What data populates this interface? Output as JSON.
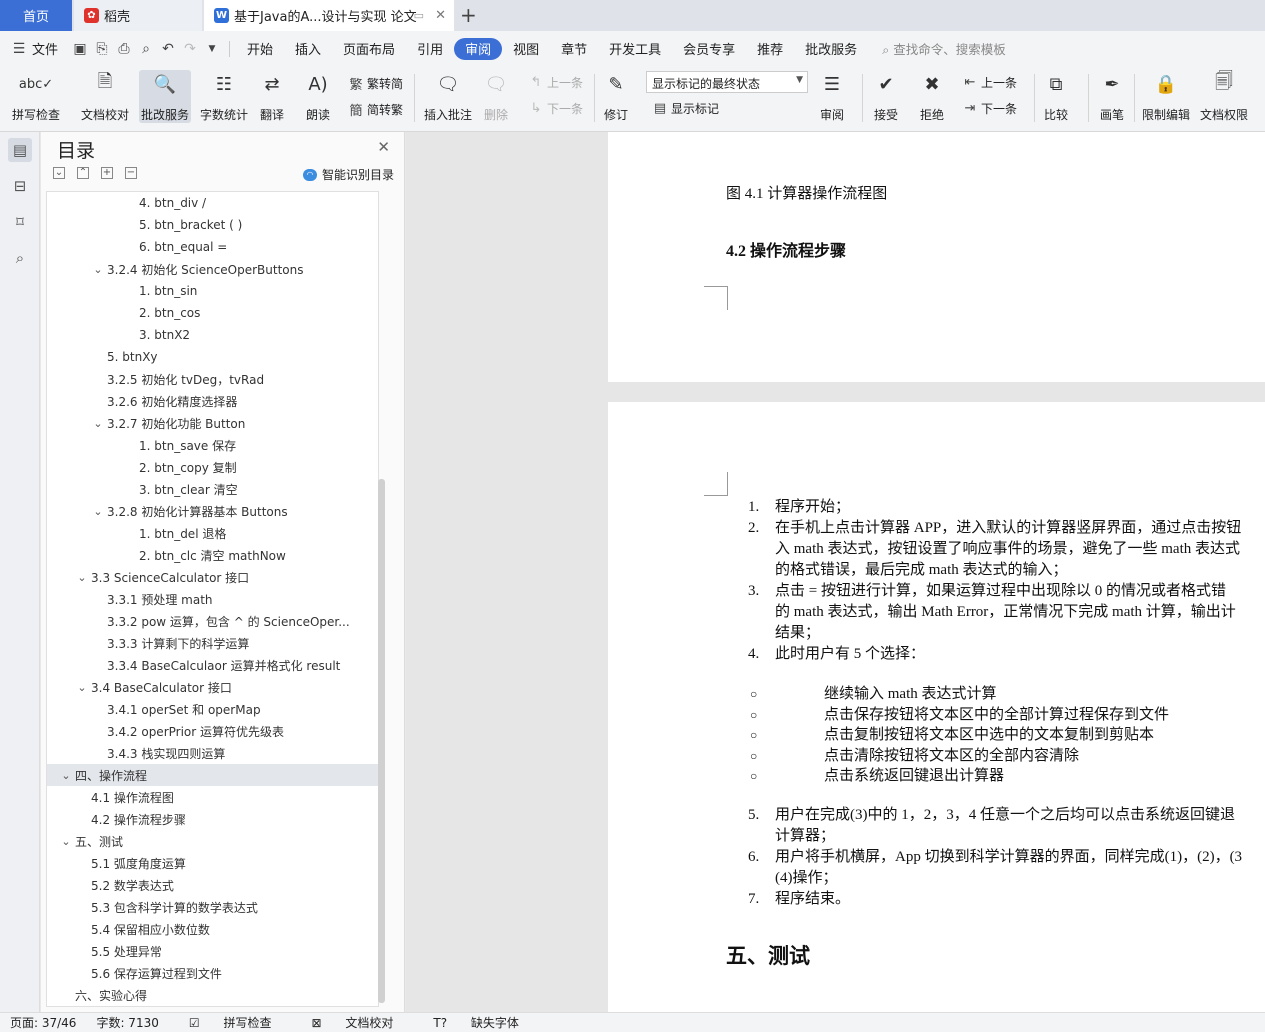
{
  "tabs": {
    "home": "首页",
    "daoke": "稻壳",
    "doc": "基于Java的A...设计与实现 论文"
  },
  "menu": {
    "file": "文件",
    "items": [
      "开始",
      "插入",
      "页面布局",
      "引用",
      "审阅",
      "视图",
      "章节",
      "开发工具",
      "会员专享",
      "推荐",
      "批改服务"
    ],
    "active_index": 4,
    "search": "查找命令、搜索模板"
  },
  "ribbon": {
    "spell": "拼写检查",
    "proofread": "文档校对",
    "correction": "批改服务",
    "wordcount": "字数统计",
    "translate": "翻译",
    "read": "朗读",
    "to_traditional": "繁转简",
    "to_simplified": "简转繁",
    "insert_comment": "插入批注",
    "delete": "删除",
    "prev": "上一条",
    "next": "下一条",
    "track": "修订",
    "markup_state": "显示标记的最终状态",
    "show_markup": "显示标记",
    "review": "审阅",
    "accept": "接受",
    "reject": "拒绝",
    "prev2": "上一条",
    "next2": "下一条",
    "compare": "比较",
    "pen": "画笔",
    "restrict": "限制编辑",
    "permission": "文档权限"
  },
  "toc": {
    "title": "目录",
    "smart": "智能识别目录",
    "items": [
      {
        "text": "4. btn_div /",
        "indent": 3
      },
      {
        "text": "5. btn_bracket ( )",
        "indent": 3
      },
      {
        "text": "6. btn_equal =",
        "indent": 3
      },
      {
        "text": "3.2.4  初始化 ScienceOperButtons",
        "indent": 2,
        "tw": "﹀"
      },
      {
        "text": "1. btn_sin",
        "indent": 3
      },
      {
        "text": "2. btn_cos",
        "indent": 3
      },
      {
        "text": "3. btnX2",
        "indent": 3
      },
      {
        "text": "5. btnXy",
        "indent": 2
      },
      {
        "text": "3.2.5  初始化 tvDeg，tvRad",
        "indent": 2
      },
      {
        "text": "3.2.6  初始化精度选择器",
        "indent": 2
      },
      {
        "text": "3.2.7  初始化功能 Button",
        "indent": 2,
        "tw": "﹀"
      },
      {
        "text": "1. btn_save  保存",
        "indent": 3
      },
      {
        "text": "2. btn_copy  复制",
        "indent": 3
      },
      {
        "text": "3. btn_clear  清空",
        "indent": 3
      },
      {
        "text": "3.2.8  初始化计算器基本 Buttons",
        "indent": 2,
        "tw": "﹀"
      },
      {
        "text": "1. btn_del  退格",
        "indent": 3
      },
      {
        "text": "2. btn_clc  清空 mathNow",
        "indent": 3
      },
      {
        "text": "3.3 ScienceCalculator 接口",
        "indent": 1,
        "tw": "﹀"
      },
      {
        "text": "3.3.1  预处理  math",
        "indent": 2
      },
      {
        "text": "3.3.2 pow  运算，包含  ^  的  ScienceOper...",
        "indent": 2
      },
      {
        "text": "3.3.3  计算剩下的科学运算",
        "indent": 2
      },
      {
        "text": "3.3.4 BaseCalculaor  运算并格式化  result",
        "indent": 2
      },
      {
        "text": "3.4 BaseCalculator  接口",
        "indent": 1,
        "tw": "﹀"
      },
      {
        "text": "3.4.1 operSet  和  operMap",
        "indent": 2
      },
      {
        "text": "3.4.2 operPrior  运算符优先级表",
        "indent": 2
      },
      {
        "text": "3.4.3  栈实现四则运算",
        "indent": 2
      },
      {
        "text": "四、操作流程",
        "indent": 0,
        "tw": "﹀",
        "selected": true
      },
      {
        "text": "4.1  操作流程图",
        "indent": 1
      },
      {
        "text": "4.2  操作流程步骤",
        "indent": 1
      },
      {
        "text": "五、测试",
        "indent": 0,
        "tw": "﹀"
      },
      {
        "text": "5.1  弧度角度运算",
        "indent": 1
      },
      {
        "text": "5.2  数学表达式",
        "indent": 1
      },
      {
        "text": "5.3  包含科学计算的数学表达式",
        "indent": 1
      },
      {
        "text": "5.4  保留相应小数位数",
        "indent": 1
      },
      {
        "text": "5.5  处理异常",
        "indent": 1
      },
      {
        "text": "5.6  保存运算过程到文件",
        "indent": 1
      },
      {
        "text": "六、实验心得",
        "indent": 0
      }
    ]
  },
  "doc": {
    "fig_caption": "图 4.1  计算器操作流程图",
    "heading_42": "4.2  操作流程步骤",
    "steps": [
      {
        "num": "1.",
        "lines": [
          "程序开始；"
        ]
      },
      {
        "num": "2.",
        "lines": [
          "在手机上点击计算器 APP，进入默认的计算器竖屏界面，通过点击按钮",
          "入 math 表达式，按钮设置了响应事件的场景，避免了一些 math  表达式",
          "的格式错误，最后完成 math  表达式的输入；"
        ]
      },
      {
        "num": "3.",
        "lines": [
          "点击  =  按钮进行计算，如果运算过程中出现除以 0 的情况或者格式错",
          "的 math 表达式，输出 Math Error，正常情况下完成 math 计算，输出计",
          "结果；"
        ]
      },
      {
        "num": "4.",
        "lines": [
          "此时用户有 5 个选择："
        ]
      }
    ],
    "bullets": [
      "继续输入 math 表达式计算",
      "点击保存按钮将文本区中的全部计算过程保存到文件",
      "点击复制按钮将文本区中选中的文本复制到剪贴本",
      "点击清除按钮将文本区的全部内容清除",
      "点击系统返回键退出计算器"
    ],
    "steps2": [
      {
        "num": "5.",
        "lines": [
          "用户在完成(3)中的 1，2，3，4 任意一个之后均可以点击系统返回键退",
          "计算器；"
        ]
      },
      {
        "num": "6.",
        "lines": [
          "用户将手机横屏，App 切换到科学计算器的界面，同样完成(1)，(2)，(3",
          "(4)操作；"
        ]
      },
      {
        "num": "7.",
        "lines": [
          "程序结束。"
        ]
      }
    ],
    "heading_5": "五、测试"
  },
  "status": {
    "page": "页面: 37/46",
    "words": "字数: 7130",
    "spell": "拼写检查",
    "proof": "文档校对",
    "font": "缺失字体"
  }
}
